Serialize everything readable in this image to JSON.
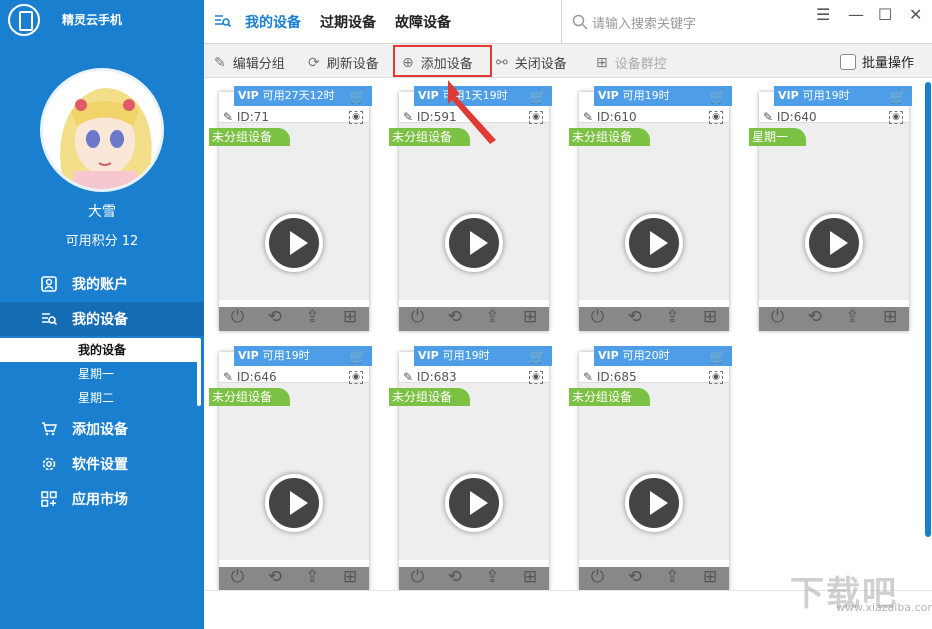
{
  "app": {
    "brand": "精灵云手机"
  },
  "user": {
    "name": "大雪",
    "points": "可用积分 12"
  },
  "sidebar": {
    "items": [
      {
        "label": "我的账户",
        "icon": "account-icon"
      },
      {
        "label": "我的设备",
        "icon": "devices-icon"
      },
      {
        "label": "添加设备",
        "icon": "cart-icon"
      },
      {
        "label": "软件设置",
        "icon": "gear-icon"
      },
      {
        "label": "应用市场",
        "icon": "apps-icon"
      }
    ],
    "subitems": [
      "我的设备",
      "星期一",
      "星期二"
    ]
  },
  "top": {
    "tabs": [
      "我的设备",
      "过期设备",
      "故障设备"
    ],
    "search_placeholder": "请输入搜索关键字",
    "win": {
      "min": "—",
      "max": "☐",
      "close": "✕",
      "menu": "☰"
    }
  },
  "toolbar": {
    "items": [
      "编辑分组",
      "刷新设备",
      "添加设备",
      "关闭设备",
      "设备群控"
    ],
    "batch": "批量操作"
  },
  "devices": [
    {
      "vip": "VIP",
      "avail": "可用27天12时",
      "id": "ID:71",
      "group": "未分组设备"
    },
    {
      "vip": "VIP",
      "avail": "可用1天19时",
      "id": "ID:591",
      "group": "未分组设备"
    },
    {
      "vip": "VIP",
      "avail": "可用19时",
      "id": "ID:610",
      "group": "未分组设备"
    },
    {
      "vip": "VIP",
      "avail": "可用19时",
      "id": "ID:640",
      "group": "星期一"
    },
    {
      "vip": "VIP",
      "avail": "可用19时",
      "id": "ID:646",
      "group": "未分组设备"
    },
    {
      "vip": "VIP",
      "avail": "可用19时",
      "id": "ID:683",
      "group": "未分组设备"
    },
    {
      "vip": "VIP",
      "avail": "可用20时",
      "id": "ID:685",
      "group": "未分组设备"
    }
  ],
  "watermark": {
    "logo": "下载吧",
    "site": "www.xiazaiba.com"
  },
  "colors": {
    "sidebar": "#1a7fcf",
    "vip": "#4d9ee6",
    "group": "#7bc143",
    "highlight": "#e03a35"
  }
}
